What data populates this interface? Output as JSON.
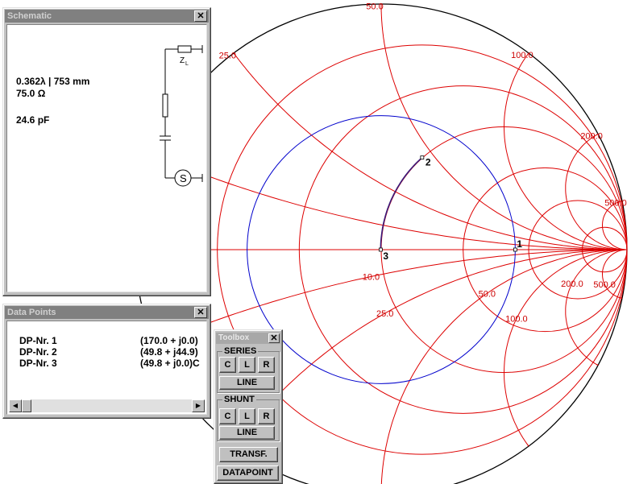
{
  "smith_chart": {
    "resistance_labels": [
      "10.0",
      "25.0",
      "50.0",
      "100.0",
      "200.0",
      "500.0"
    ],
    "reactance_positive_labels": [
      "25.0",
      "50.0",
      "100.0",
      "200.0",
      "500.0"
    ],
    "reactance_negative_labels": [
      "10.0",
      "25.0",
      "50.0",
      "100.0",
      "200.0",
      "500.0"
    ],
    "data_point_markers": [
      "1",
      "2",
      "3"
    ],
    "colors": {
      "grid": "#dd0000",
      "circle": "#0000cc",
      "path": "#3a1a7a"
    }
  },
  "schematic": {
    "title": "Schematic",
    "close": "✕",
    "line_length": "0.362λ | 753 mm",
    "impedance": "75.0  Ω",
    "capacitance": "24.6 pF",
    "load_label": "Z",
    "load_sub": "L",
    "source_symbol": "S"
  },
  "data_points": {
    "title": "Data Points",
    "close": "✕",
    "rows": [
      {
        "label": "DP-Nr. 1",
        "value": "(170.0 + j0.0)"
      },
      {
        "label": "DP-Nr. 2",
        "value": "(49.8 + j44.9)"
      },
      {
        "label": "DP-Nr. 3",
        "value": "(49.8 + j0.0)C"
      }
    ]
  },
  "toolbox": {
    "title": "Toolbox",
    "close": "✕",
    "series_label": "SERIES",
    "shunt_label": "SHUNT",
    "c": "C",
    "l": "L",
    "r": "R",
    "line": "LINE",
    "transf": "TRANSF.",
    "datapoint": "DATAPOINT"
  }
}
